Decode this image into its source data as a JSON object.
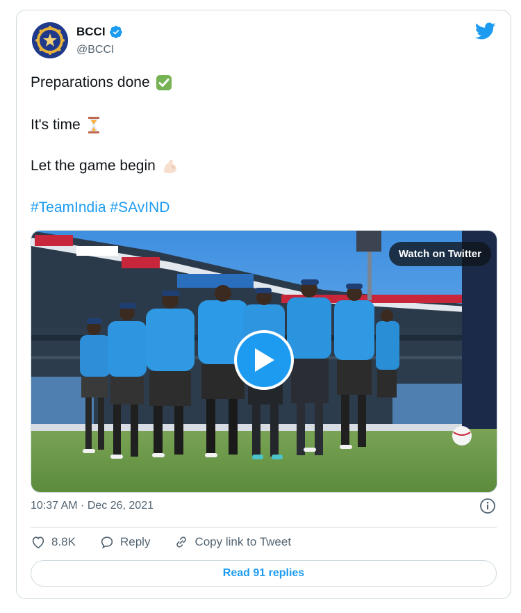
{
  "author": {
    "name": "BCCI",
    "handle": "@BCCI",
    "verified": true
  },
  "tweet": {
    "line1": "Preparations done",
    "line1_emoji": "check-mark-button-emoji",
    "line2": "It's time",
    "line2_emoji": "hourglass-emoji",
    "line3": "Let the game begin",
    "line3_emoji": "flexed-biceps-emoji",
    "hashtags": "#TeamIndia #SAvIND"
  },
  "media": {
    "type": "video",
    "watch_label": "Watch on Twitter"
  },
  "timestamp": "10:37 AM · Dec 26, 2021",
  "actions": {
    "likes": "8.8K",
    "reply_label": "Reply",
    "copy_label": "Copy link to Tweet"
  },
  "read_replies_label": "Read 91 replies",
  "colors": {
    "accent": "#1d9bf0",
    "text": "#0f1419",
    "muted": "#536471",
    "border": "#cfd9de"
  }
}
